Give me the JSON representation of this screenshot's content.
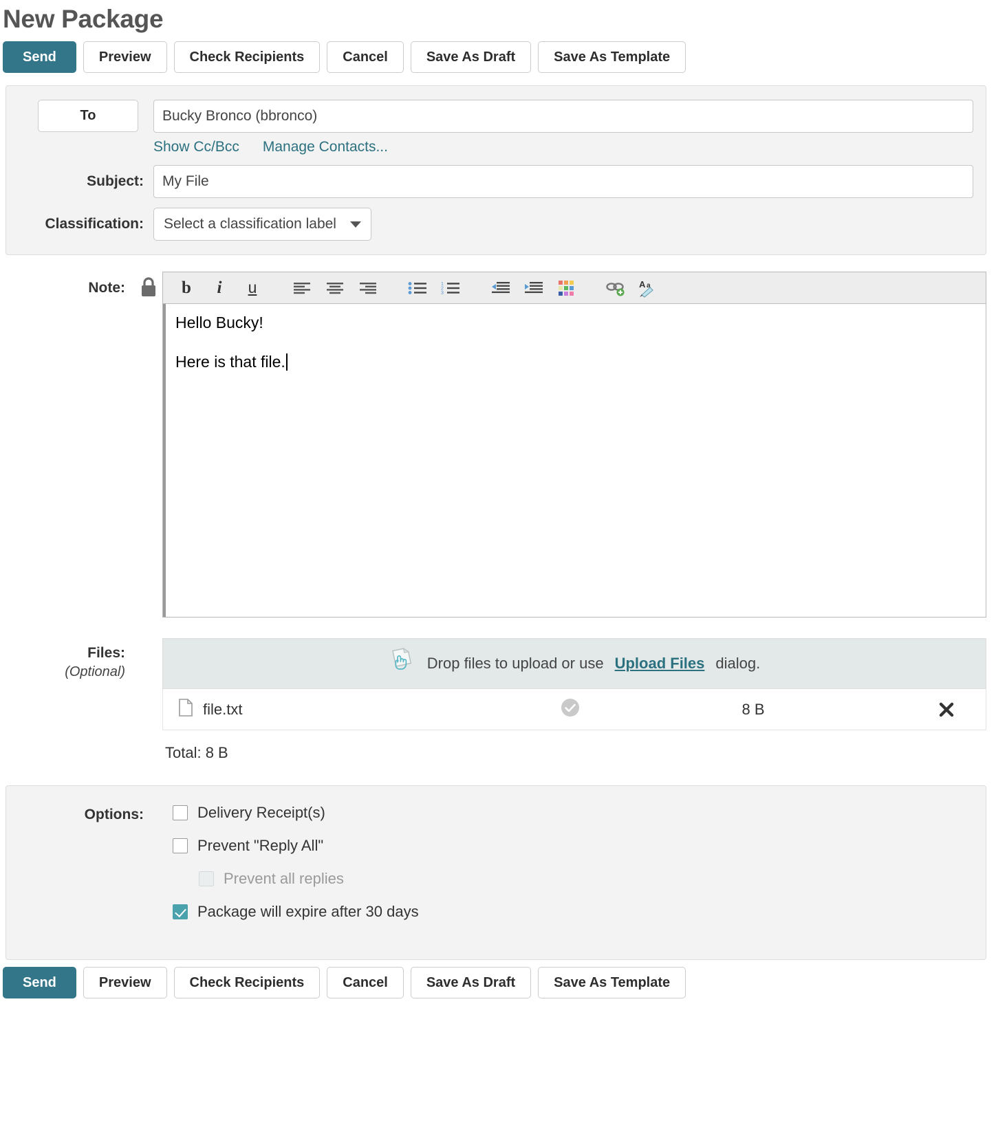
{
  "page_title": "New Package",
  "toolbar_buttons": [
    {
      "label": "Send",
      "primary": true
    },
    {
      "label": "Preview",
      "primary": false
    },
    {
      "label": "Check Recipients",
      "primary": false
    },
    {
      "label": "Cancel",
      "primary": false
    },
    {
      "label": "Save As Draft",
      "primary": false
    },
    {
      "label": "Save As Template",
      "primary": false
    }
  ],
  "header": {
    "to_button_label": "To",
    "to_value": "Bucky Bronco (bbronco)",
    "to_placeholder": "",
    "show_cc_bcc_label": "Show Cc/Bcc",
    "manage_contacts_label": "Manage Contacts...",
    "subject_label": "Subject:",
    "subject_value": "My File",
    "subject_placeholder": "",
    "classification_label": "Classification:",
    "classification_value": "Select a classification label"
  },
  "note": {
    "label": "Note:",
    "lock_icon": "lock-icon",
    "toolbar": [
      {
        "name": "bold-icon",
        "glyph": "b"
      },
      {
        "name": "italic-icon",
        "glyph": "i"
      },
      {
        "name": "underline-icon",
        "glyph": "u"
      },
      {
        "name": "align-left-icon",
        "glyph": ""
      },
      {
        "name": "align-center-icon",
        "glyph": ""
      },
      {
        "name": "align-right-icon",
        "glyph": ""
      },
      {
        "name": "bulleted-list-icon",
        "glyph": ""
      },
      {
        "name": "numbered-list-icon",
        "glyph": ""
      },
      {
        "name": "outdent-icon",
        "glyph": ""
      },
      {
        "name": "indent-icon",
        "glyph": ""
      },
      {
        "name": "text-color-palette-icon",
        "glyph": ""
      },
      {
        "name": "insert-link-icon",
        "glyph": ""
      },
      {
        "name": "spell-check-icon",
        "glyph": "Aa"
      }
    ],
    "body_lines": [
      "Hello Bucky!",
      "Here is that file."
    ]
  },
  "files": {
    "label": "Files:",
    "optional_label": "(Optional)",
    "drop_text_before": "Drop files to upload or use",
    "upload_link_label": "Upload Files",
    "drop_text_after": "dialog.",
    "rows": [
      {
        "name": "file.txt",
        "status_icon": "check-circle-icon",
        "size": "8 B",
        "remove_icon": "close-icon"
      }
    ],
    "total_label": "Total: 8 B"
  },
  "options": {
    "label": "Options:",
    "items": [
      {
        "label": "Delivery Receipt(s)",
        "checked": false,
        "disabled": false,
        "indented": false
      },
      {
        "label": "Prevent \"Reply All\"",
        "checked": false,
        "disabled": false,
        "indented": false
      },
      {
        "label": "Prevent all replies",
        "checked": false,
        "disabled": true,
        "indented": true
      },
      {
        "label": "Package will expire after 30 days",
        "checked": true,
        "disabled": false,
        "indented": false
      }
    ]
  },
  "colors": {
    "accent": "#33768a",
    "link": "#2c7180",
    "checkbox_checked": "#4aa2ad",
    "panel_bg": "#f3f3f3",
    "dropzone_bg": "#e3e9e9"
  }
}
